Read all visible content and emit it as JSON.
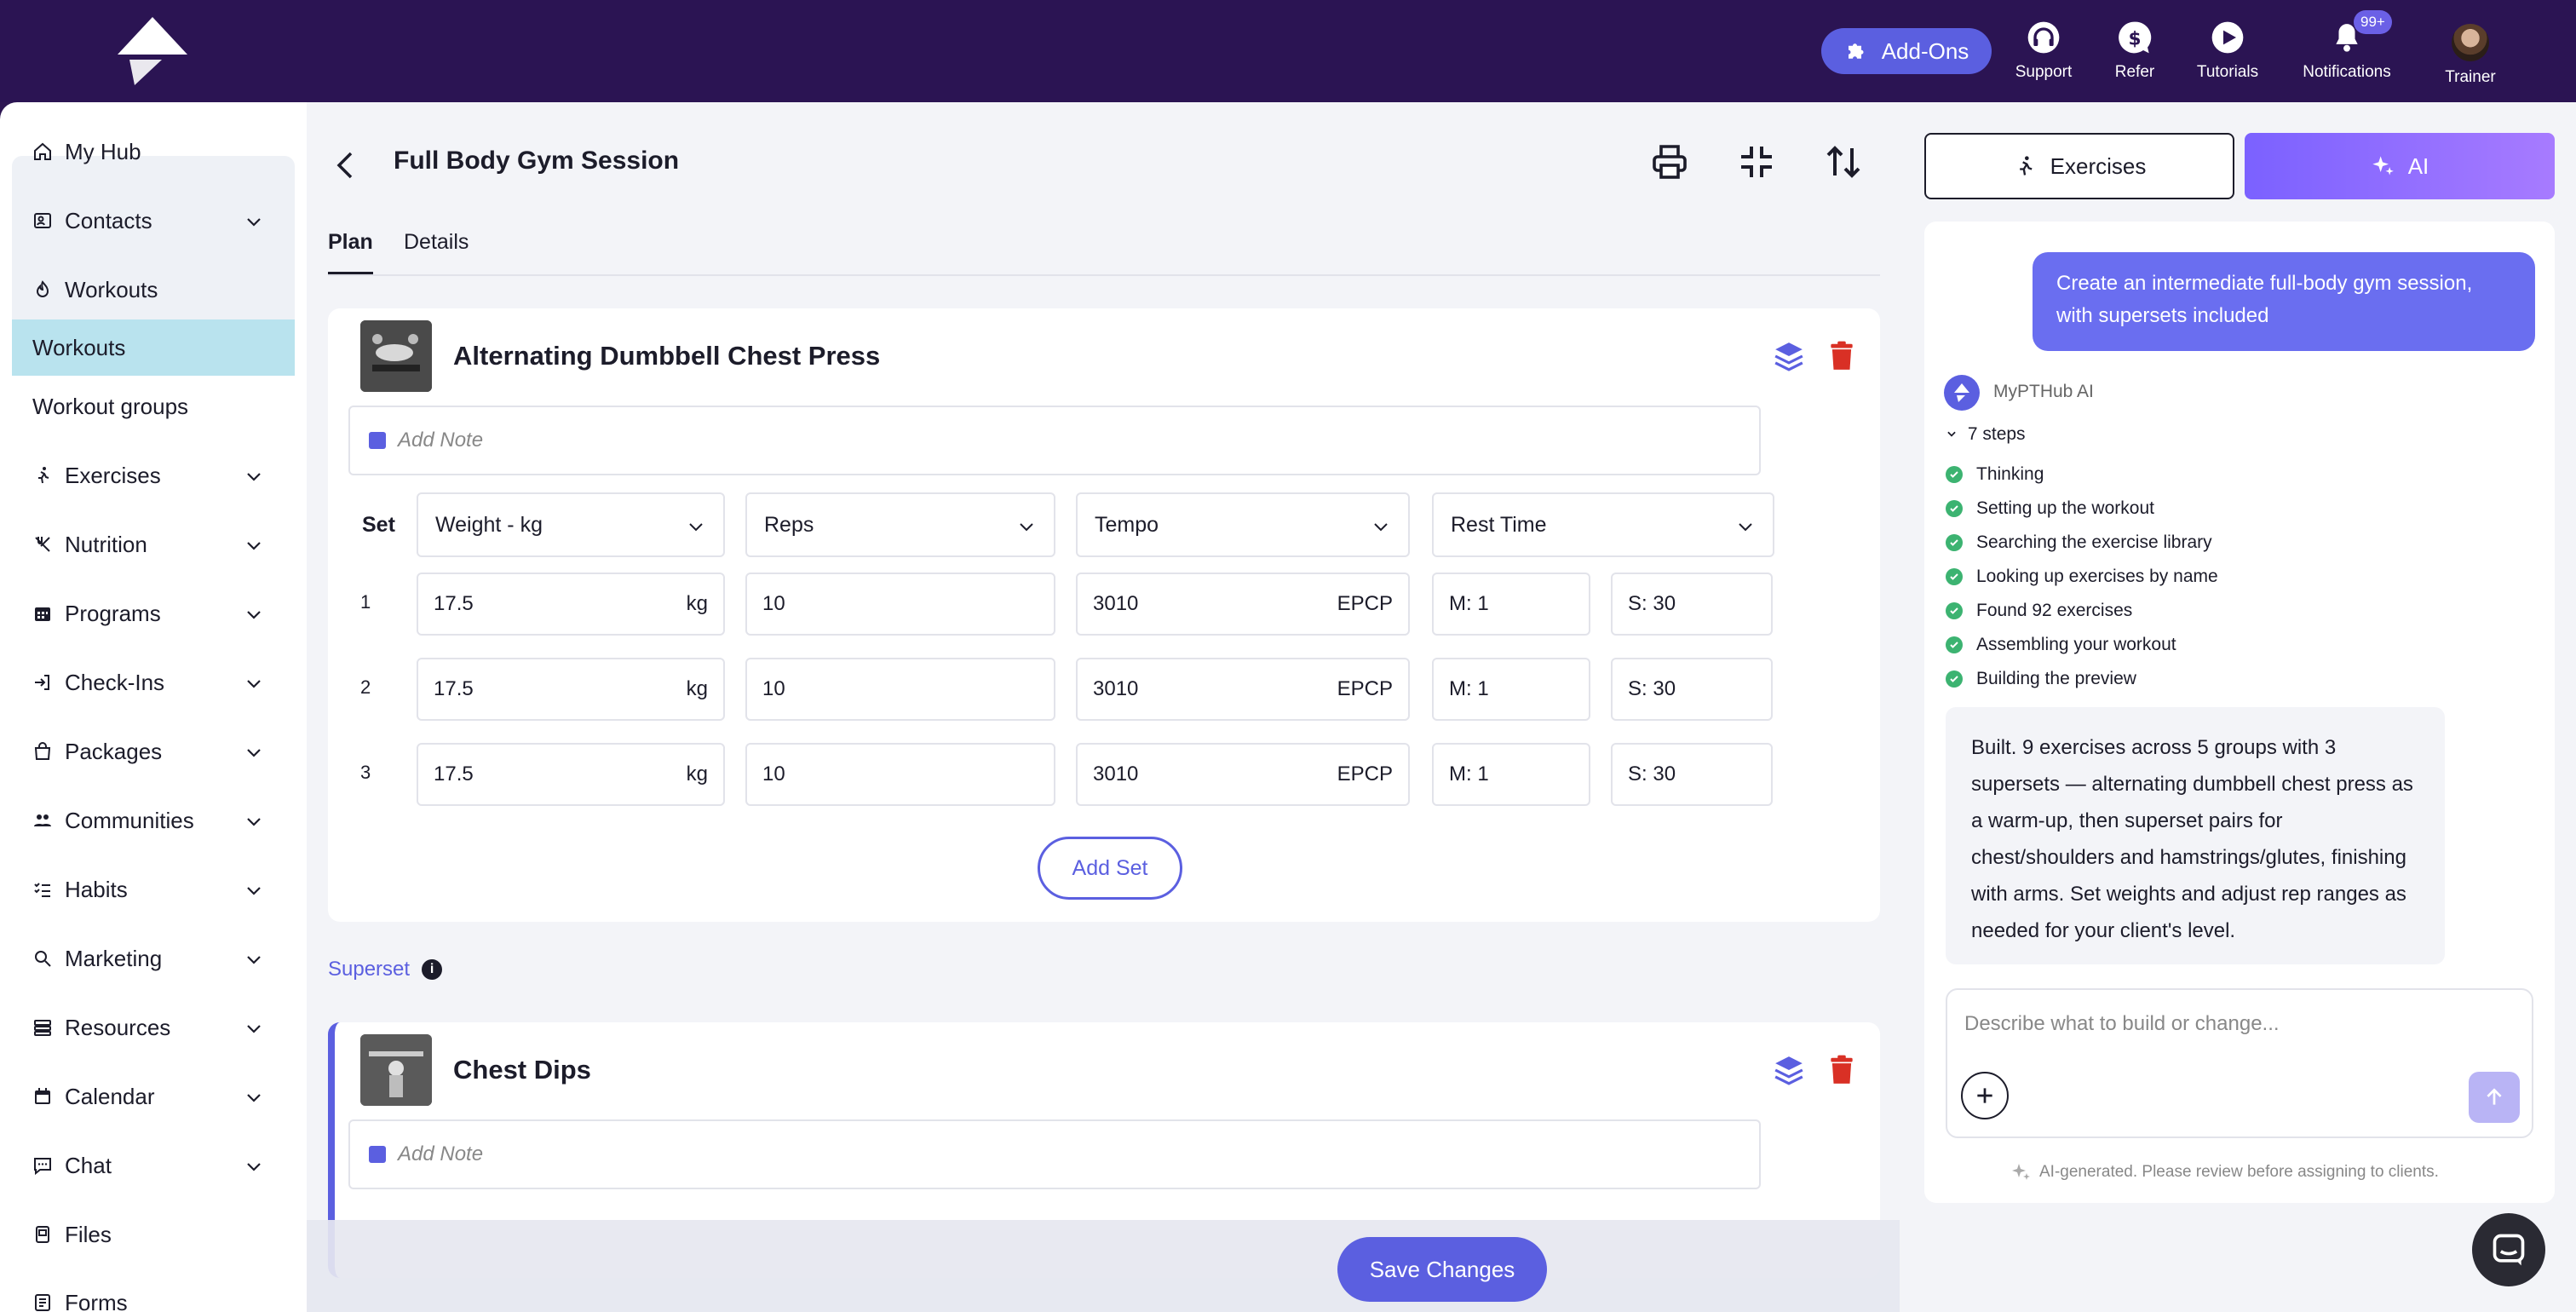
{
  "topbar": {
    "addons_label": "Add-Ons",
    "support_label": "Support",
    "refer_label": "Refer",
    "tutorials_label": "Tutorials",
    "notifications_label": "Notifications",
    "notifications_badge": "99+",
    "trainer_label": "Trainer"
  },
  "sidebar": {
    "items": [
      {
        "label": "My Hub",
        "icon": "home-icon"
      },
      {
        "label": "Contacts",
        "icon": "contacts-icon"
      },
      {
        "label": "Workouts",
        "icon": "workouts-icon"
      },
      {
        "label": "Exercises",
        "icon": "running-icon"
      },
      {
        "label": "Nutrition",
        "icon": "utensils-icon"
      },
      {
        "label": "Programs",
        "icon": "calendar-grid-icon"
      },
      {
        "label": "Check-Ins",
        "icon": "login-icon"
      },
      {
        "label": "Packages",
        "icon": "package-icon"
      },
      {
        "label": "Communities",
        "icon": "community-icon"
      },
      {
        "label": "Habits",
        "icon": "checklist-icon"
      },
      {
        "label": "Marketing",
        "icon": "search-icon"
      },
      {
        "label": "Resources",
        "icon": "stack-icon"
      },
      {
        "label": "Calendar",
        "icon": "calendar-icon"
      },
      {
        "label": "Chat",
        "icon": "chat-icon"
      },
      {
        "label": "Files",
        "icon": "files-icon"
      },
      {
        "label": "Forms",
        "icon": "forms-icon"
      }
    ],
    "sub_workouts": "Workouts",
    "sub_groups": "Workout groups"
  },
  "main": {
    "title": "Full Body Gym Session",
    "tabs": [
      "Plan",
      "Details"
    ],
    "exercise1": {
      "name": "Alternating Dumbbell Chest Press",
      "note_placeholder": "Add Note",
      "set_header": "Set",
      "columns": [
        "Weight - kg",
        "Reps",
        "Tempo",
        "Rest Time"
      ],
      "rows": [
        {
          "set": "1",
          "weight": "17.5",
          "unit": "kg",
          "reps": "10",
          "tempo": "3010",
          "tempo_unit": "EPCP",
          "rest_m": "M:  1",
          "rest_s": "S:  30"
        },
        {
          "set": "2",
          "weight": "17.5",
          "unit": "kg",
          "reps": "10",
          "tempo": "3010",
          "tempo_unit": "EPCP",
          "rest_m": "M:  1",
          "rest_s": "S:  30"
        },
        {
          "set": "3",
          "weight": "17.5",
          "unit": "kg",
          "reps": "10",
          "tempo": "3010",
          "tempo_unit": "EPCP",
          "rest_m": "M:  1",
          "rest_s": "S:  30"
        }
      ],
      "add_set_label": "Add Set"
    },
    "superset_label": "Superset",
    "exercise2": {
      "name": "Chest Dips",
      "note_placeholder": "Add Note"
    },
    "save_label": "Save Changes"
  },
  "panel": {
    "exercises_label": "Exercises",
    "ai_label": "AI",
    "user_message": "Create an intermediate full-body gym session, with supersets included",
    "ai_name": "MyPTHub AI",
    "steps_header": "7 steps",
    "steps": [
      "Thinking",
      "Setting up the workout",
      "Searching the exercise library",
      "Looking up exercises by name",
      "Found 92 exercises",
      "Assembling your workout",
      "Building the preview"
    ],
    "reply": "Built. 9 exercises across 5 groups with 3 supersets — alternating dumbbell chest press as a warm-up, then superset pairs for chest/shoulders and hamstrings/glutes, finishing with arms. Set weights and adjust rep ranges as needed for your client's level.",
    "input_placeholder": "Describe what to build or change...",
    "disclaimer": "AI-generated. Please review before assigning to clients."
  },
  "colors": {
    "topbar": "#2b1453",
    "accent": "#5b5fe0",
    "delete": "#d93025",
    "success": "#3cb371"
  }
}
